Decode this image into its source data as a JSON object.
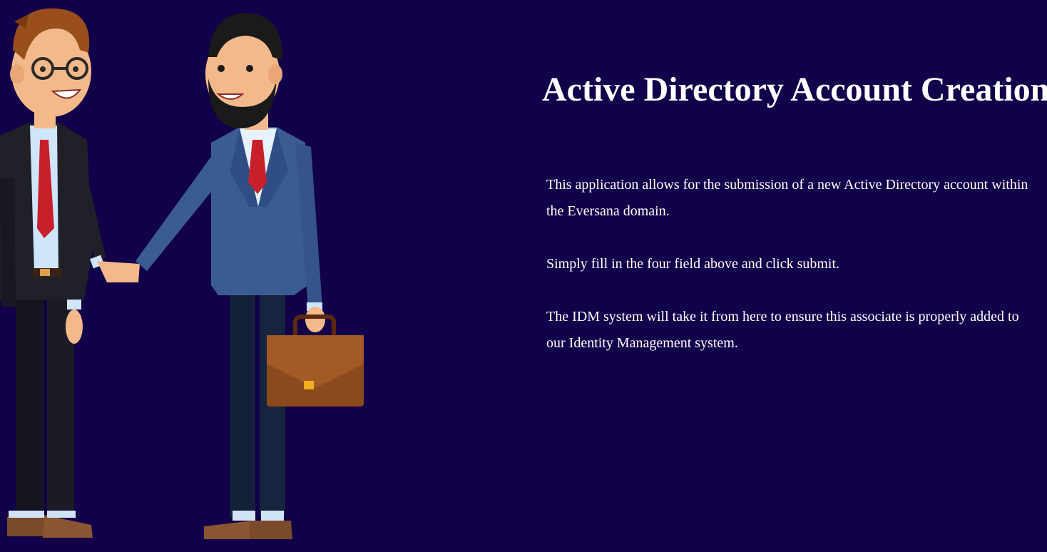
{
  "page": {
    "background_color": "#12004a",
    "text_color": "#ffffff",
    "title": "Active Directory Account Creation",
    "paragraphs": [
      "This application allows for the submission of a new Active Directory account within the Eversana domain.",
      "Simply fill in the four field above and click submit.",
      "The IDM system will take it from here to ensure this associate is properly added to our Identity Management system."
    ]
  },
  "illustration": {
    "icon": "businessmen-handshake-illustration"
  }
}
